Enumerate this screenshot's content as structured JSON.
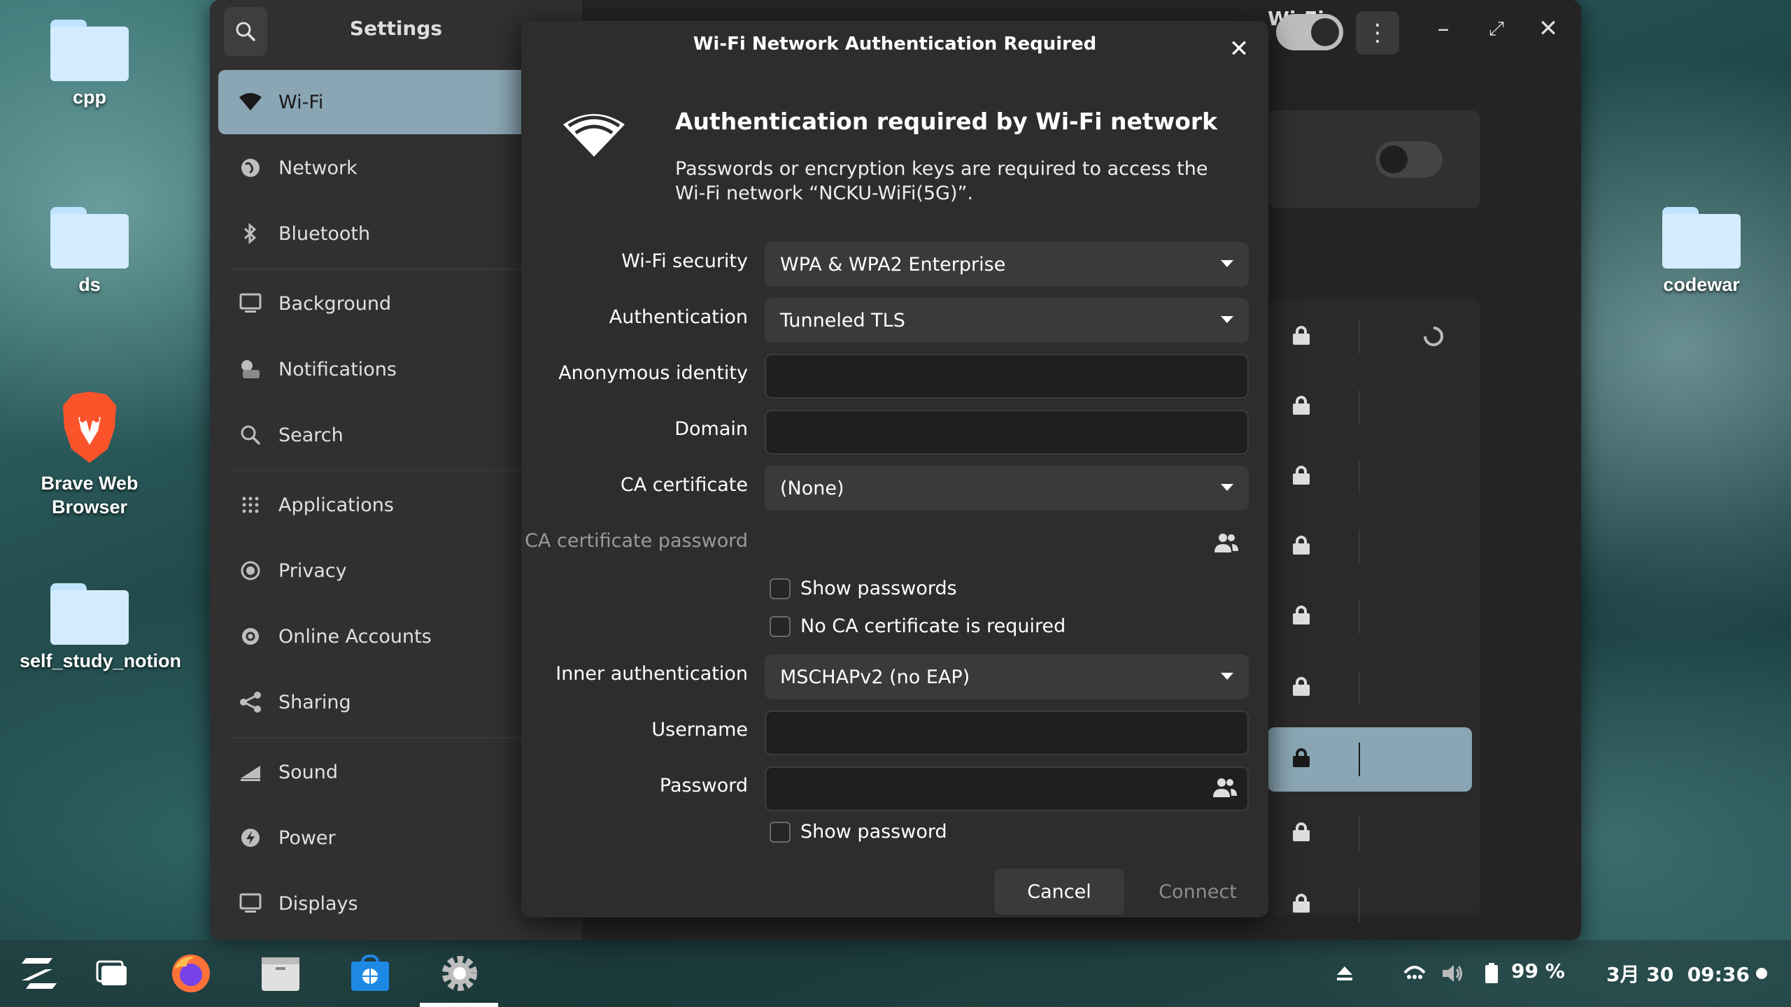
{
  "desktop": {
    "icons": [
      {
        "label": "cpp"
      },
      {
        "label": "ds"
      },
      {
        "label": "Brave Web Browser"
      },
      {
        "label": "self_study_notion"
      },
      {
        "label": "codewar"
      }
    ]
  },
  "settings": {
    "title": "Settings",
    "sidebar_items": [
      {
        "label": "Wi-Fi",
        "icon": "wifi-icon"
      },
      {
        "label": "Network",
        "icon": "network-icon"
      },
      {
        "label": "Bluetooth",
        "icon": "bluetooth-icon"
      },
      {
        "label": "Background",
        "icon": "background-icon"
      },
      {
        "label": "Notifications",
        "icon": "notifications-icon"
      },
      {
        "label": "Search",
        "icon": "search-icon"
      },
      {
        "label": "Applications",
        "icon": "applications-icon"
      },
      {
        "label": "Privacy",
        "icon": "privacy-icon"
      },
      {
        "label": "Online Accounts",
        "icon": "online-accounts-icon"
      },
      {
        "label": "Sharing",
        "icon": "sharing-icon"
      },
      {
        "label": "Sound",
        "icon": "sound-icon"
      },
      {
        "label": "Power",
        "icon": "power-icon"
      },
      {
        "label": "Displays",
        "icon": "displays-icon"
      }
    ],
    "header_title": "Wi-Fi"
  },
  "dialog": {
    "title": "Wi-Fi Network Authentication Required",
    "heading": "Authentication required by Wi-Fi network",
    "description": "Passwords or encryption keys are required to access the Wi-Fi network “NCKU-WiFi(5G)”.",
    "fields": {
      "wifi_security": {
        "label": "Wi-Fi security",
        "value": "WPA & WPA2 Enterprise"
      },
      "authentication": {
        "label": "Authentication",
        "value": "Tunneled TLS"
      },
      "anonymous_identity": {
        "label": "Anonymous identity",
        "value": ""
      },
      "domain": {
        "label": "Domain",
        "value": ""
      },
      "ca_certificate": {
        "label": "CA certificate",
        "value": "(None)"
      },
      "ca_certificate_password": {
        "label": "CA certificate password",
        "value": ""
      },
      "show_passwords": {
        "label": "Show passwords",
        "checked": false
      },
      "no_ca_required": {
        "label": "No CA certificate is required",
        "checked": false
      },
      "inner_authentication": {
        "label": "Inner authentication",
        "value": "MSCHAPv2 (no EAP)"
      },
      "username": {
        "label": "Username",
        "value": ""
      },
      "password": {
        "label": "Password",
        "value": ""
      },
      "show_password": {
        "label": "Show password",
        "checked": false
      }
    },
    "cancel_label": "Cancel",
    "connect_label": "Connect"
  },
  "taskbar": {
    "battery": "99 %",
    "clock": "3月 30  09:36"
  },
  "colors": {
    "accent": "#8aa6b4",
    "dialog_bg": "#2d2d2d",
    "sidebar_bg": "#303030"
  }
}
